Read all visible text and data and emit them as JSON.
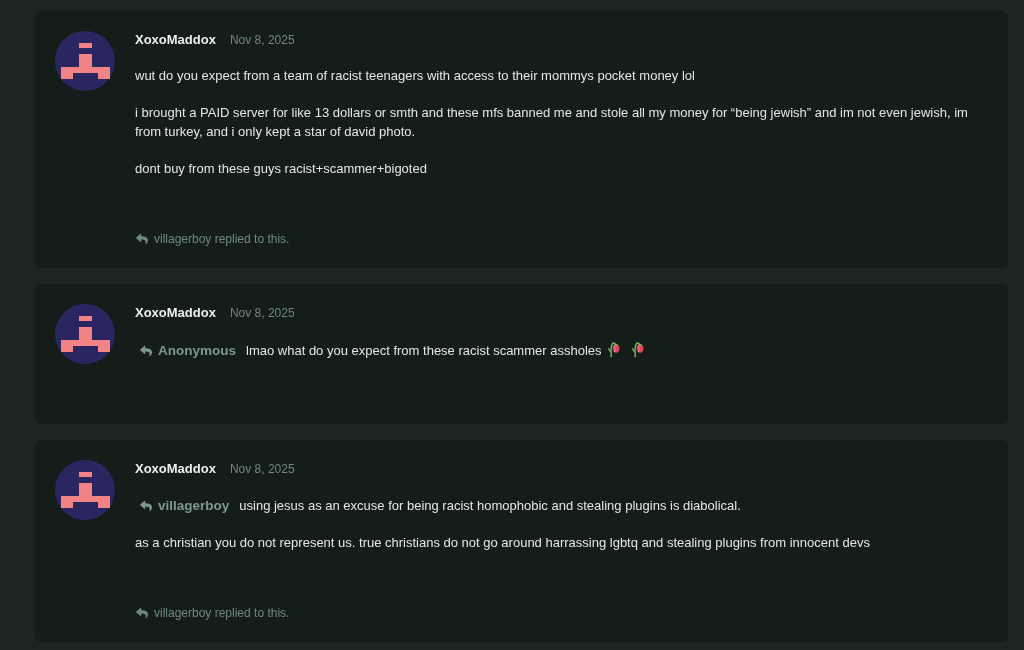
{
  "posts": [
    {
      "author": "XoxoMaddox",
      "date": "Nov 8, 2025",
      "paragraphs": [
        {
          "text": "wut do you expect from a team of racist teenagers with access to their mommys pocket money lol"
        },
        {
          "text": "i brought a PAID server for like 13 dollars or smth and these mfs banned me and stole all my money for “being jewish” and im not even jewish, im from turkey, and i only kept a star of david photo."
        },
        {
          "text": "dont buy from these guys racist+scammer+bigoted"
        }
      ],
      "footer": "villagerboy replied to this."
    },
    {
      "author": "XoxoMaddox",
      "date": "Nov 8, 2025",
      "paragraphs": [
        {
          "mention": "Anonymous",
          "text": "lmao what do you expect from these racist scammer assholes",
          "emojis": [
            {
              "kind": "flower"
            },
            {
              "kind": "flower"
            }
          ]
        }
      ]
    },
    {
      "author": "XoxoMaddox",
      "date": "Nov 8, 2025",
      "paragraphs": [
        {
          "mention": "villagerboy",
          "text": "using jesus as an excuse for being racist homophobic and stealing plugins is diabolical."
        },
        {
          "text": "as a christian you do not represent us. true christians do not go around harrassing lgbtq and stealing plugins from innocent devs"
        }
      ],
      "footer": "villagerboy replied to this."
    }
  ]
}
